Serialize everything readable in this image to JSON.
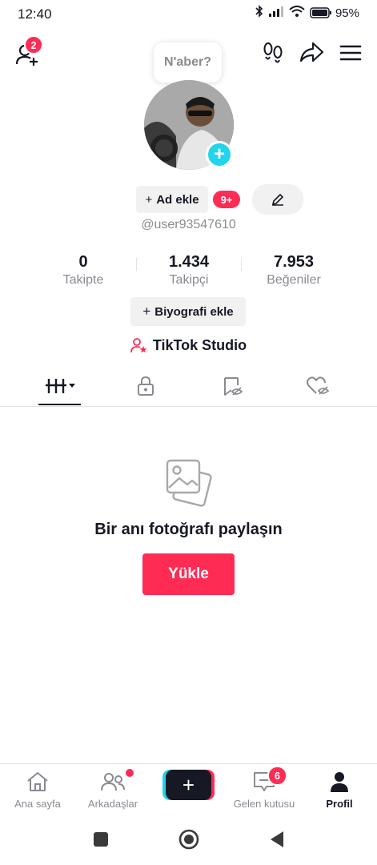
{
  "status_bar": {
    "time": "12:40",
    "battery": "95%"
  },
  "top_bar": {
    "friend_badge": "2"
  },
  "profile": {
    "bubble": "N'aber?",
    "add_ad_label": "Ad ekle",
    "notif_badge": "9+",
    "username": "@user93547610"
  },
  "stats": [
    {
      "value": "0",
      "label": "Takipte"
    },
    {
      "value": "1.434",
      "label": "Takipçi"
    },
    {
      "value": "7.953",
      "label": "Beğeniler"
    }
  ],
  "bio_button": "Biyografi ekle",
  "studio_label": "TikTok Studio",
  "empty_state": {
    "title": "Bir anı fotoğrafı paylaşın",
    "button": "Yükle"
  },
  "bottom_nav": {
    "home": "Ana sayfa",
    "friends": "Arkadaşlar",
    "inbox": "Gelen kutusu",
    "inbox_badge": "6",
    "profile": "Profil"
  },
  "colors": {
    "accent": "#fe2c55",
    "cyan": "#20d5ec",
    "text": "#161823",
    "muted": "#8a8b91"
  }
}
